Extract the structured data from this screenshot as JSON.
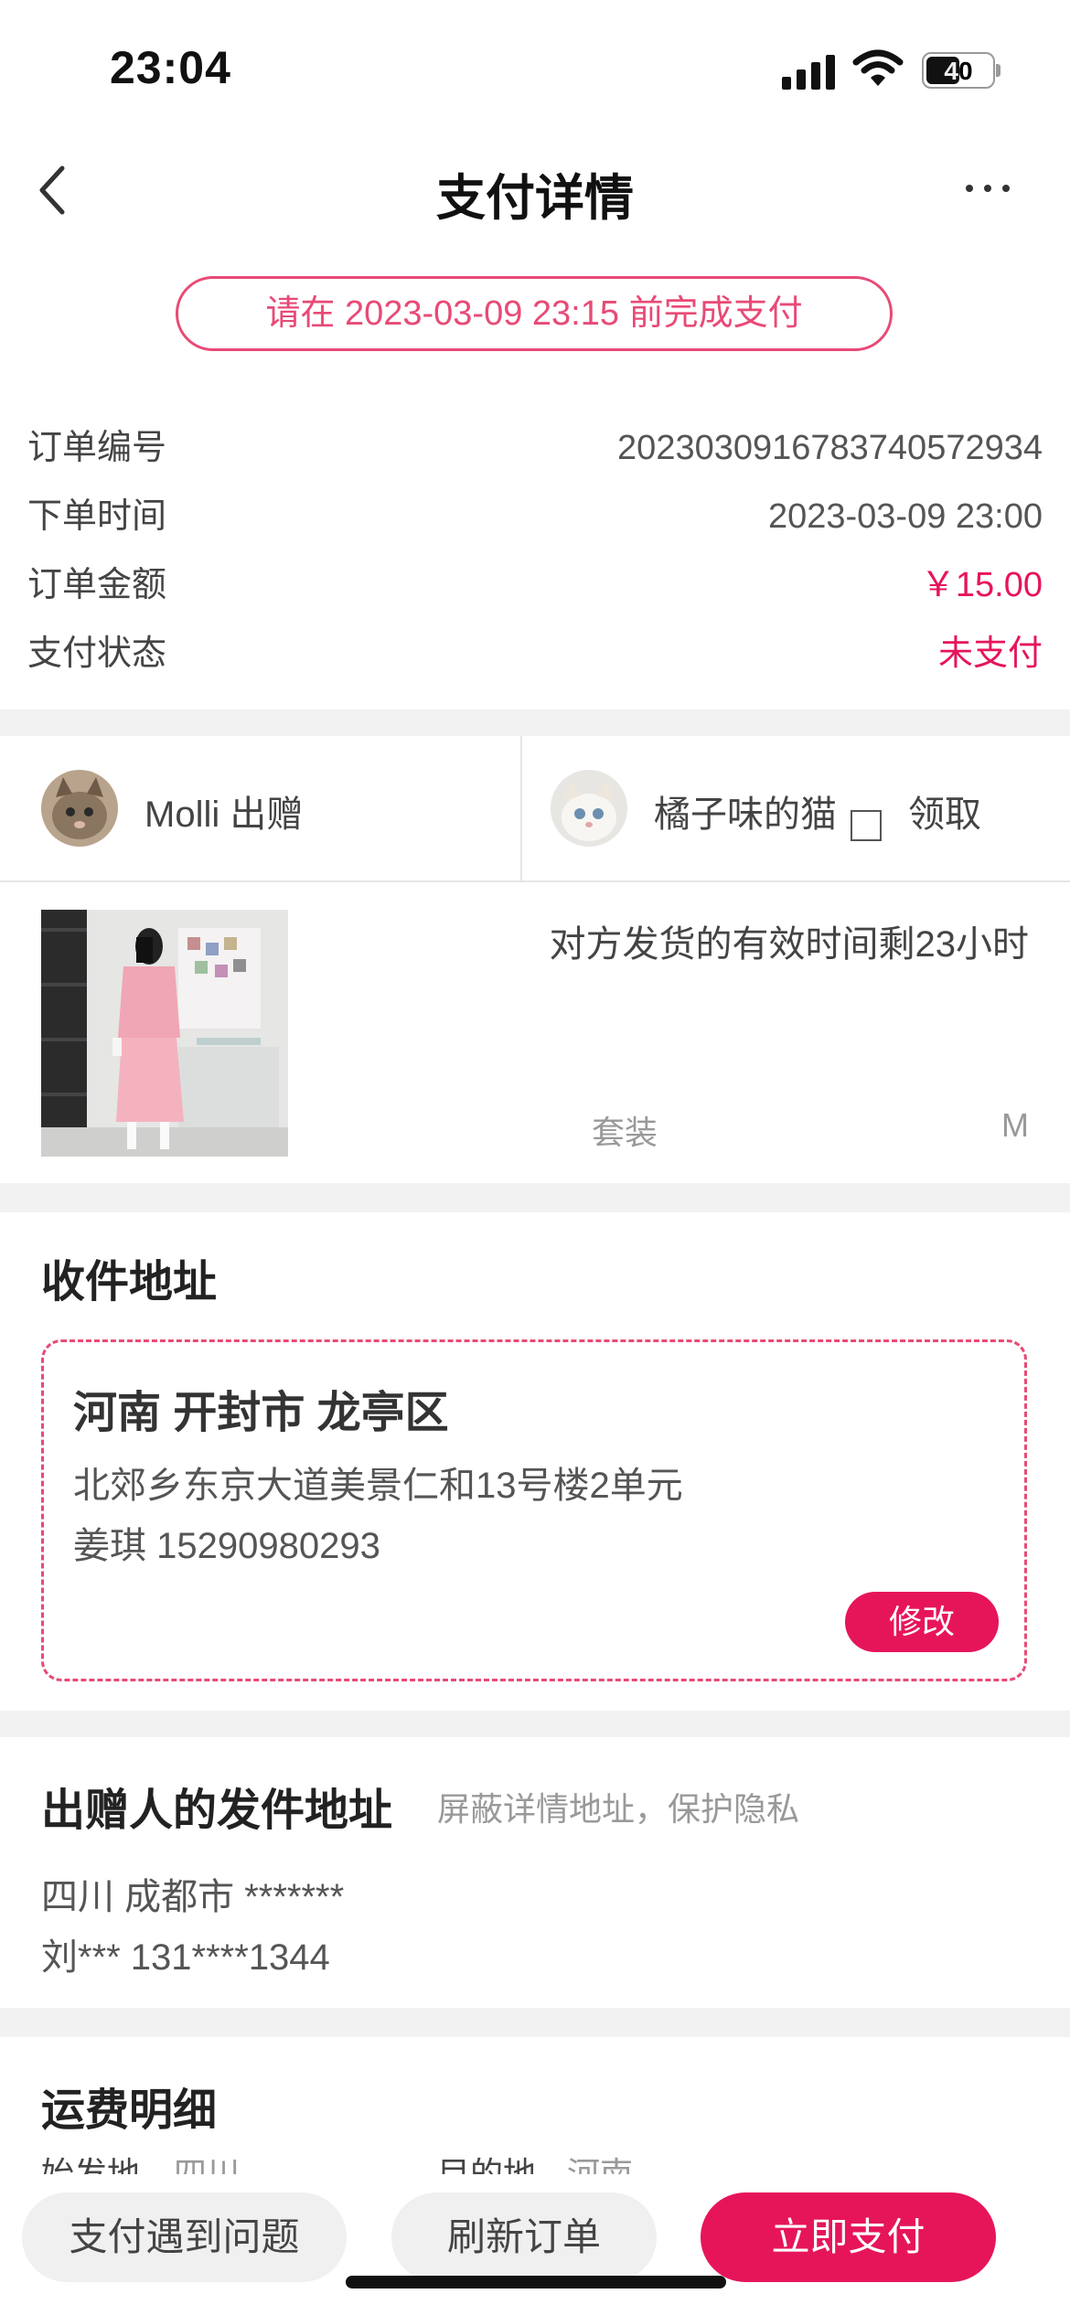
{
  "status_bar": {
    "time": "23:04",
    "battery": "40"
  },
  "nav": {
    "title": "支付详情",
    "back_icon": "chevron-left-icon",
    "more_icon": "more-icon"
  },
  "deadline": "请在 2023-03-09 23:15 前完成支付",
  "order": [
    {
      "label": "订单编号",
      "value": "20230309167837405729​34"
    },
    {
      "label": "下单时间",
      "value": "2023-03-09 23:00"
    },
    {
      "label": "订单金额",
      "value": "￥15.00"
    },
    {
      "label": "支付状态",
      "value": "未支付"
    }
  ],
  "parties": {
    "giver": {
      "name": "Molli 出赠"
    },
    "receiver": {
      "name": "橘子味的猫",
      "action": "领取"
    }
  },
  "item": {
    "shipping_time": "对方发货的有效时间剩23小时",
    "category": "套装",
    "size": "M"
  },
  "shipping_address": {
    "title": "收件地址",
    "region": "河南 开封市 龙亭区",
    "detail": "北郊乡东京大道美景仁和13号楼2单元",
    "contact": "姜琪 15290980293",
    "edit_label": "修改"
  },
  "sender_address": {
    "title": "出赠人的发件地址",
    "hint": "屏蔽详情地址，保护隐私",
    "region": "四川 成都市 *******",
    "contact": "刘*** 131****1344"
  },
  "freight": {
    "title": "运费明细",
    "from_label": "始发地",
    "from_value": "四川",
    "to_label": "目的地",
    "to_value": "河南"
  },
  "bottom": {
    "problem": "支付遇到问题",
    "refresh": "刷新订单",
    "pay": "立即支付"
  },
  "colors": {
    "accent": "#e6155a",
    "accent_light": "#e84a76"
  }
}
